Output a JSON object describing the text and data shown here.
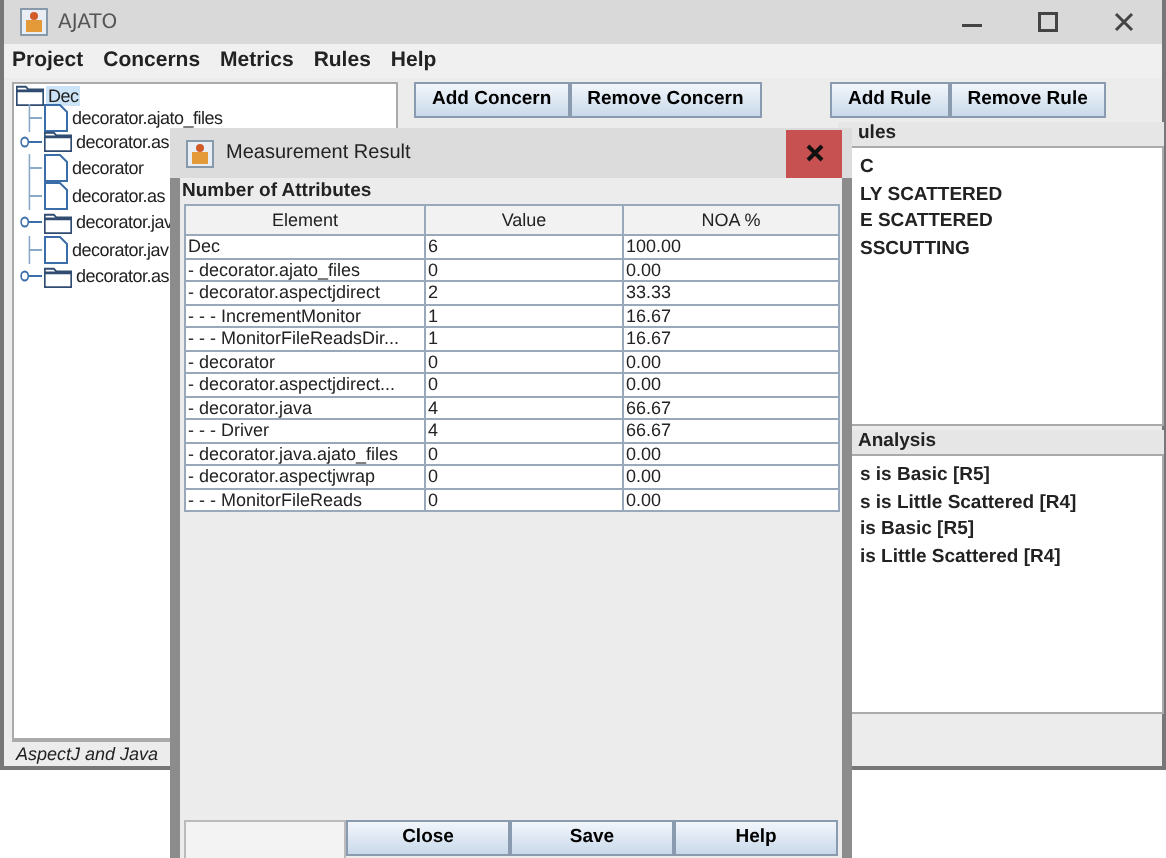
{
  "window": {
    "title": "AJATO"
  },
  "menu": [
    "Project",
    "Concerns",
    "Metrics",
    "Rules",
    "Help"
  ],
  "tree": {
    "label": "Dec",
    "kind": "folder",
    "selected": true,
    "children": [
      {
        "label": "decorator.ajato_files",
        "kind": "file",
        "selected": false
      },
      {
        "label": "decorator.as",
        "kind": "folder",
        "selected": false
      },
      {
        "label": "decorator",
        "kind": "file",
        "selected": false
      },
      {
        "label": "decorator.as",
        "kind": "file",
        "selected": false
      },
      {
        "label": "decorator.jav",
        "kind": "folder",
        "selected": false
      },
      {
        "label": "decorator.jav",
        "kind": "file",
        "selected": false
      },
      {
        "label": "decorator.as",
        "kind": "folder",
        "selected": false
      }
    ]
  },
  "status_bar": "AspectJ and Java",
  "concern_buttons": [
    "Add Concern",
    "Remove Concern"
  ],
  "rule_buttons": [
    "Add Rule",
    "Remove Rule"
  ],
  "rules": {
    "label": "ules",
    "items": [
      "C",
      "LY SCATTERED",
      "E SCATTERED",
      "SSCUTTING"
    ]
  },
  "analysis": {
    "label": "Analysis",
    "items": [
      "s is Basic [R5]",
      "s is Little Scattered [R4]",
      "is Basic [R5]",
      "is Little Scattered [R4]"
    ]
  },
  "dialog": {
    "title": "Measurement Result",
    "heading": "Number of Attributes",
    "columns": [
      "Element",
      "Value",
      "NOA %"
    ],
    "rows": [
      [
        "Dec",
        "6",
        "100.00"
      ],
      [
        "- decorator.ajato_files",
        "0",
        "0.00"
      ],
      [
        "- decorator.aspectjdirect",
        "2",
        "33.33"
      ],
      [
        "- - - IncrementMonitor",
        "1",
        "16.67"
      ],
      [
        "- - - MonitorFileReadsDir...",
        "1",
        "16.67"
      ],
      [
        "- decorator",
        "0",
        "0.00"
      ],
      [
        "- decorator.aspectjdirect...",
        "0",
        "0.00"
      ],
      [
        "- decorator.java",
        "4",
        "66.67"
      ],
      [
        "- - - Driver",
        "4",
        "66.67"
      ],
      [
        "- decorator.java.ajato_files",
        "0",
        "0.00"
      ],
      [
        "- decorator.aspectjwrap",
        "0",
        "0.00"
      ],
      [
        "- - - MonitorFileReads",
        "0",
        "0.00"
      ]
    ],
    "buttons": [
      "Close",
      "Save",
      "Help"
    ]
  }
}
